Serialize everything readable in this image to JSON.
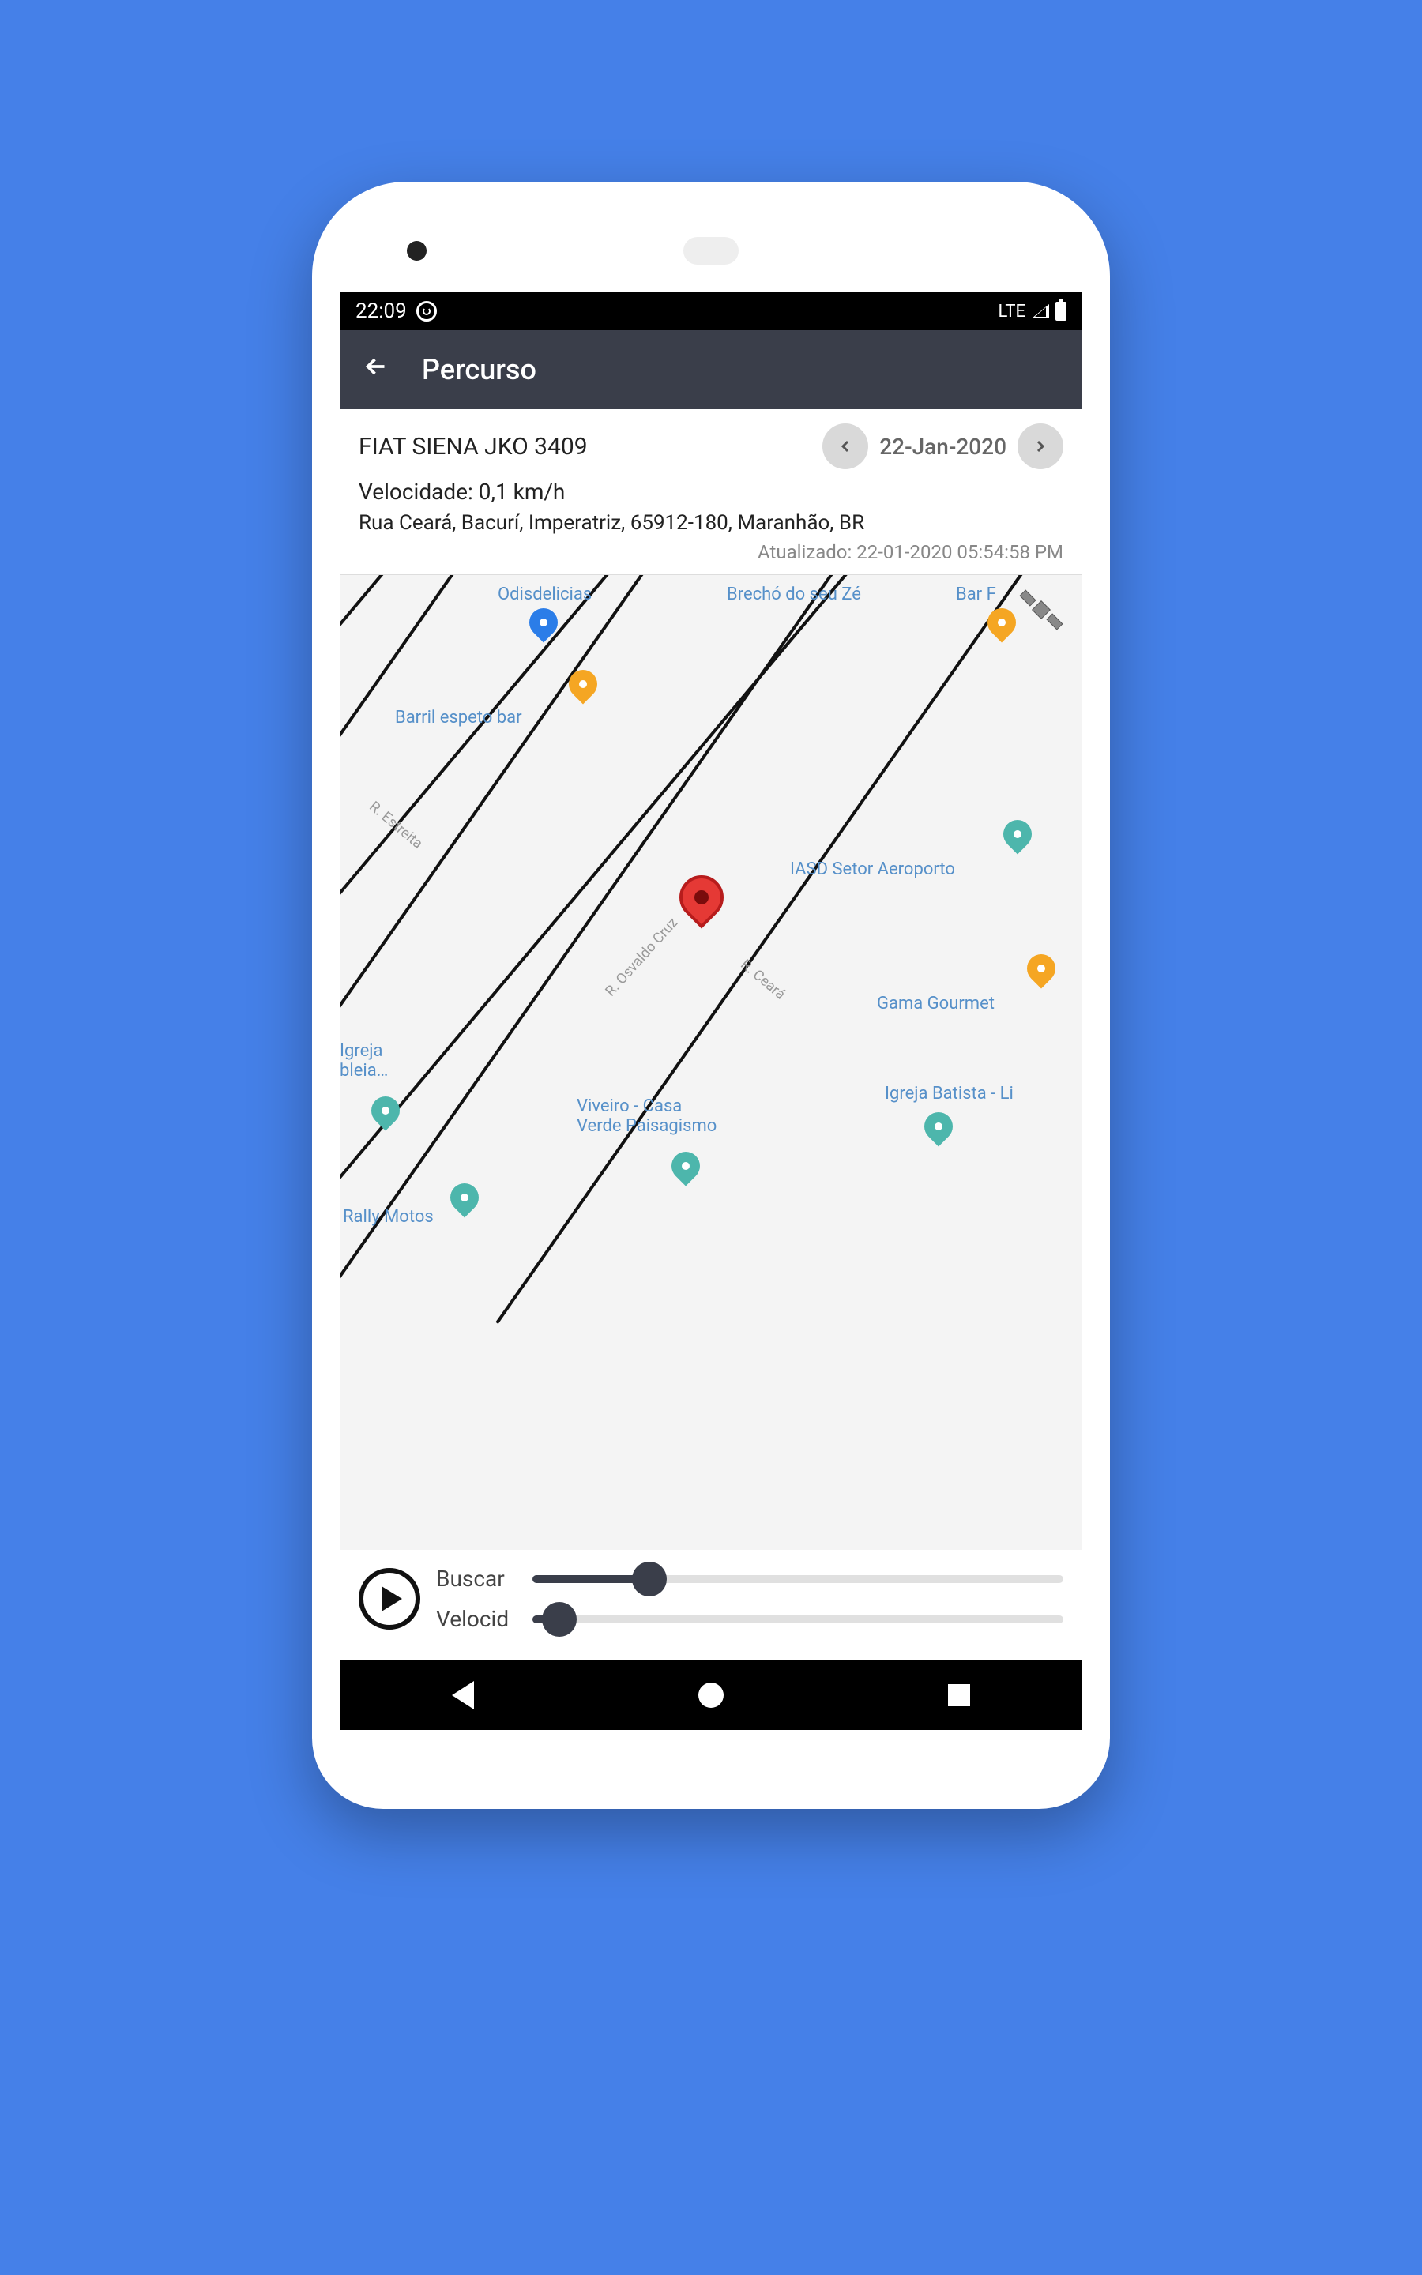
{
  "status": {
    "time": "22:09",
    "network": "LTE"
  },
  "header": {
    "title": "Percurso"
  },
  "info": {
    "vehicle": "FIAT SIENA JKO 3409",
    "date": "22-Jan-2020",
    "speed_line": "Velocidade: 0,1 km/h",
    "address": "Rua Ceará, Bacurí, Imperatriz, 65912-180, Maranhão, BR",
    "updated": "Atualizado: 22-01-2020 05:54:58 PM"
  },
  "map": {
    "pois": {
      "odisdelicias": "Odisdelicias",
      "brecho": "Brechó do seu Zé",
      "barf": "Bar F",
      "barril": "Barril espeto bar",
      "iasd": "IASD Setor Aeroporto",
      "gama": "Gama Gourmet",
      "igreja_left": "Igreja\nbleia…",
      "viveiro": "Viveiro - Casa\nVerde Paisagismo",
      "igreja_batista": "Igreja Batista - Li",
      "rally": "Rally Motos"
    },
    "streets": {
      "estreita": "R. Estreita",
      "osvaldo": "R. Osvaldo Cruz",
      "ceara": "R. Ceará"
    }
  },
  "controls": {
    "play": "play",
    "slider1_label": "Buscar",
    "slider2_label": "Velocid"
  }
}
